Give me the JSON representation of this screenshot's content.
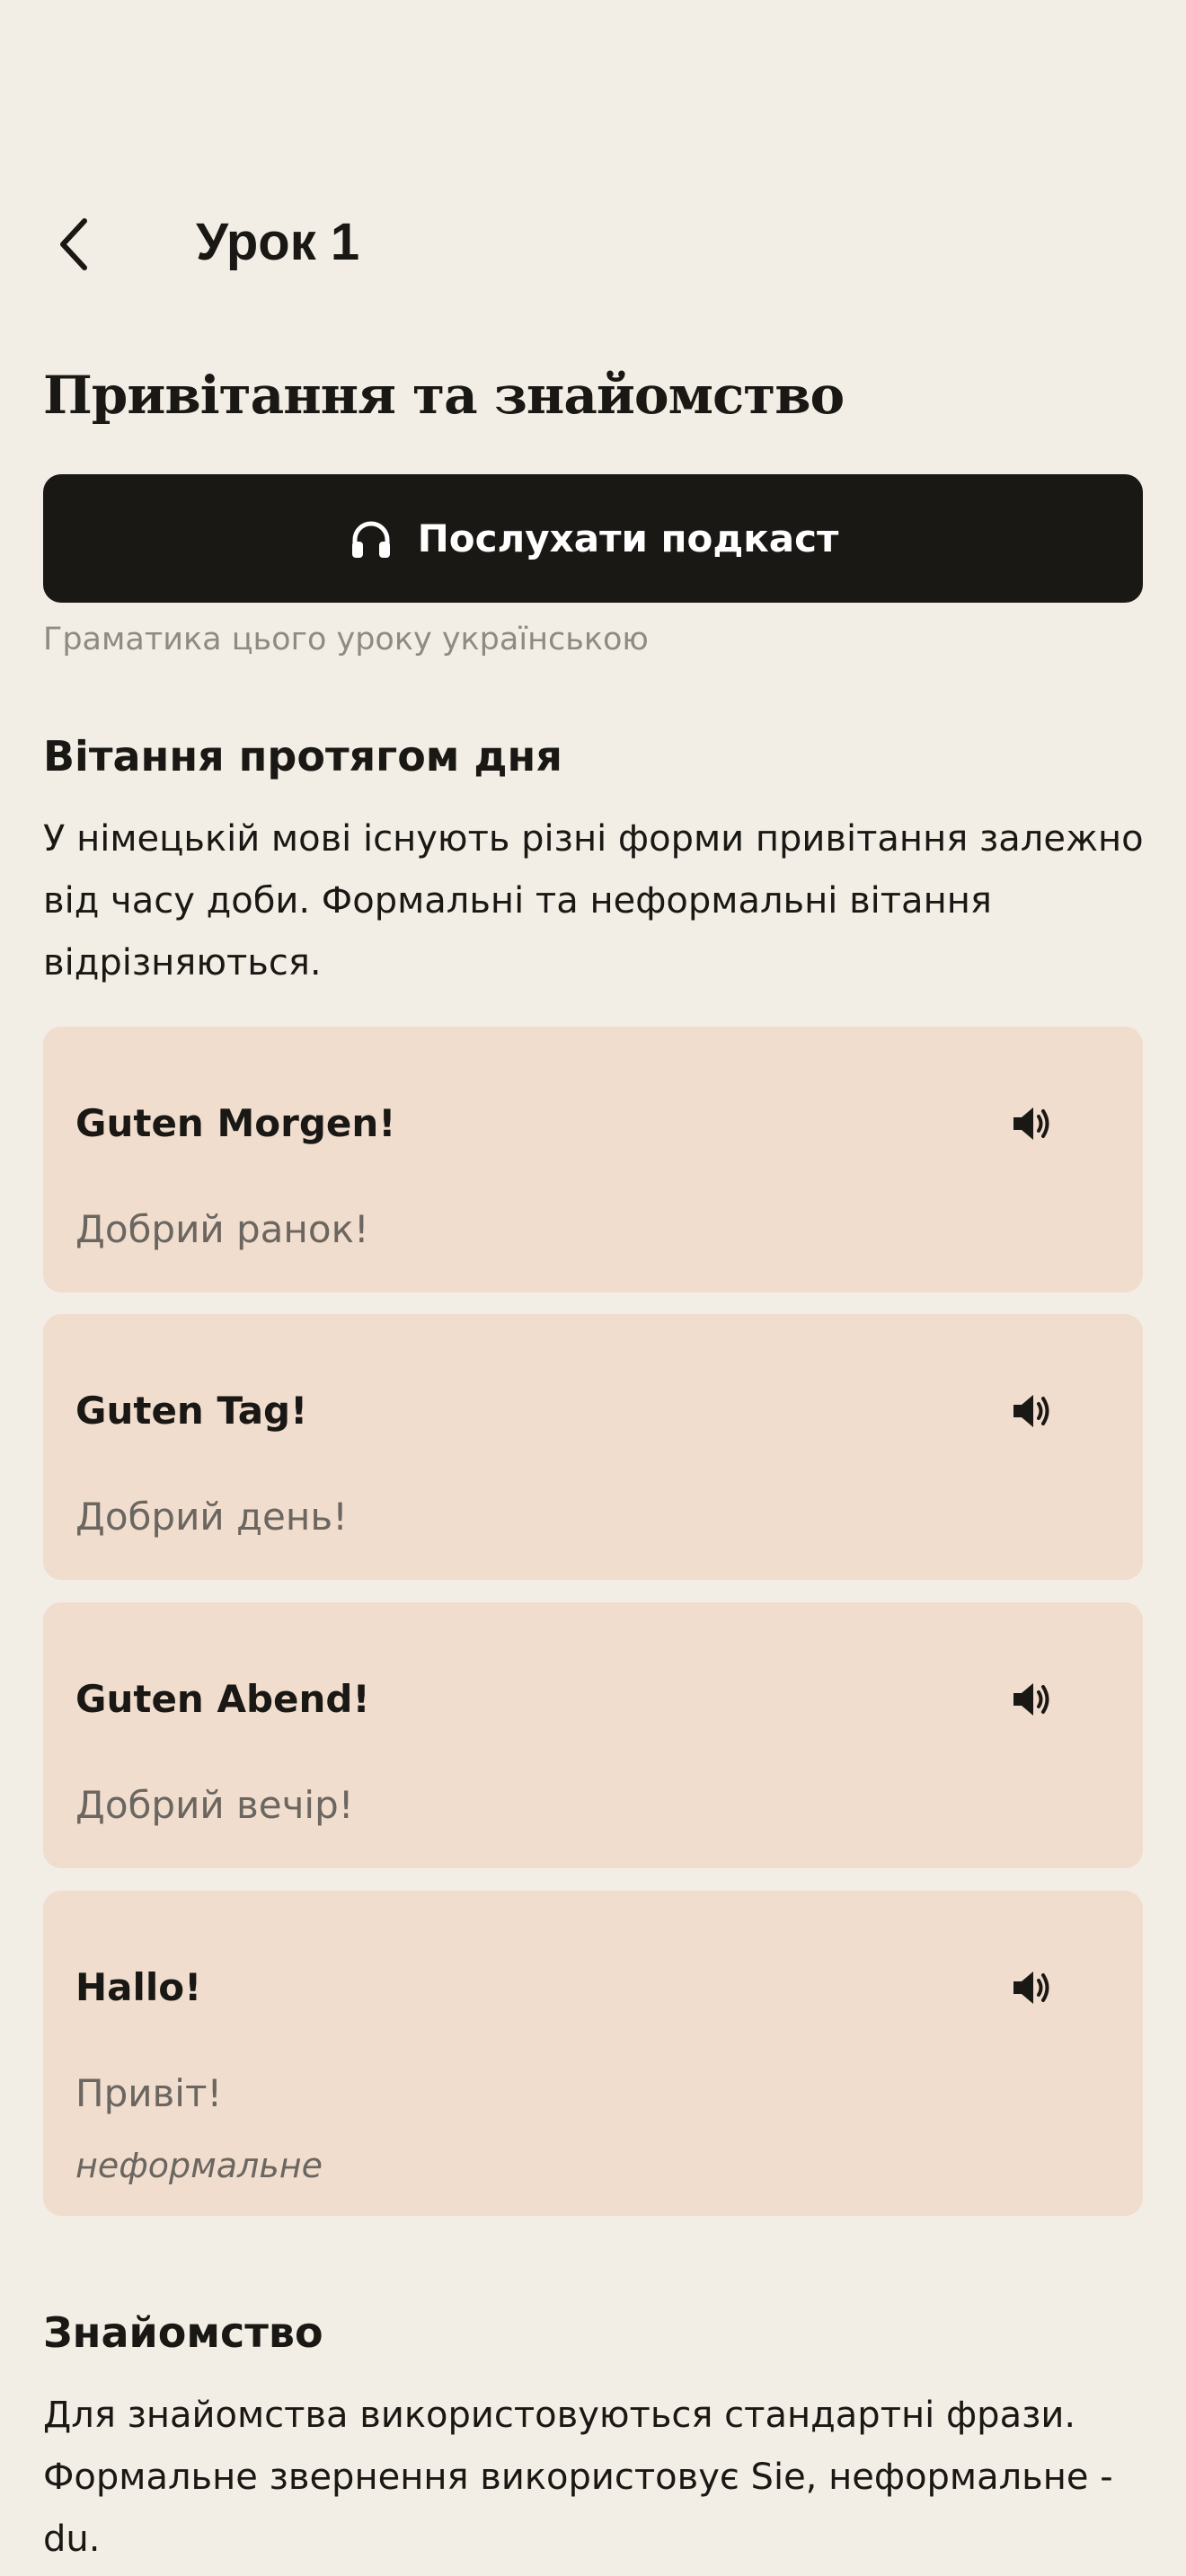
{
  "header": {
    "title": "Урок 1"
  },
  "lesson": {
    "title": "Привітання та знайомство",
    "podcast_button_label": "Послухати подкаст",
    "grammar_note": "Граматика цього уроку українською"
  },
  "sections": [
    {
      "heading": "Вітання протягом дня",
      "text": "У німецькій мові існують різні форми привітання залежно від часу доби. Формальні та неформальні вітання відрізняються.",
      "phrases": [
        {
          "german": "Guten Morgen!",
          "ukrainian": "Добрий ранок!"
        },
        {
          "german": "Guten Tag!",
          "ukrainian": "Добрий день!"
        },
        {
          "german": "Guten Abend!",
          "ukrainian": "Добрий вечір!"
        },
        {
          "german": "Hallo!",
          "ukrainian": "Привіт!",
          "note": "неформальне"
        }
      ]
    },
    {
      "heading": "Знайомство",
      "text": "Для знайомства використовуються стандартні фрази. Формальне звернення використовує Sie, неформальне - du."
    }
  ],
  "icons": {
    "back": "chevron-left-icon",
    "podcast": "headphones-icon",
    "speaker": "speaker-icon"
  },
  "colors": {
    "background": "#F3EEE5",
    "primary_button": "#1A1814",
    "card": "#F0DDCD",
    "muted_text": "#8E8A84"
  }
}
